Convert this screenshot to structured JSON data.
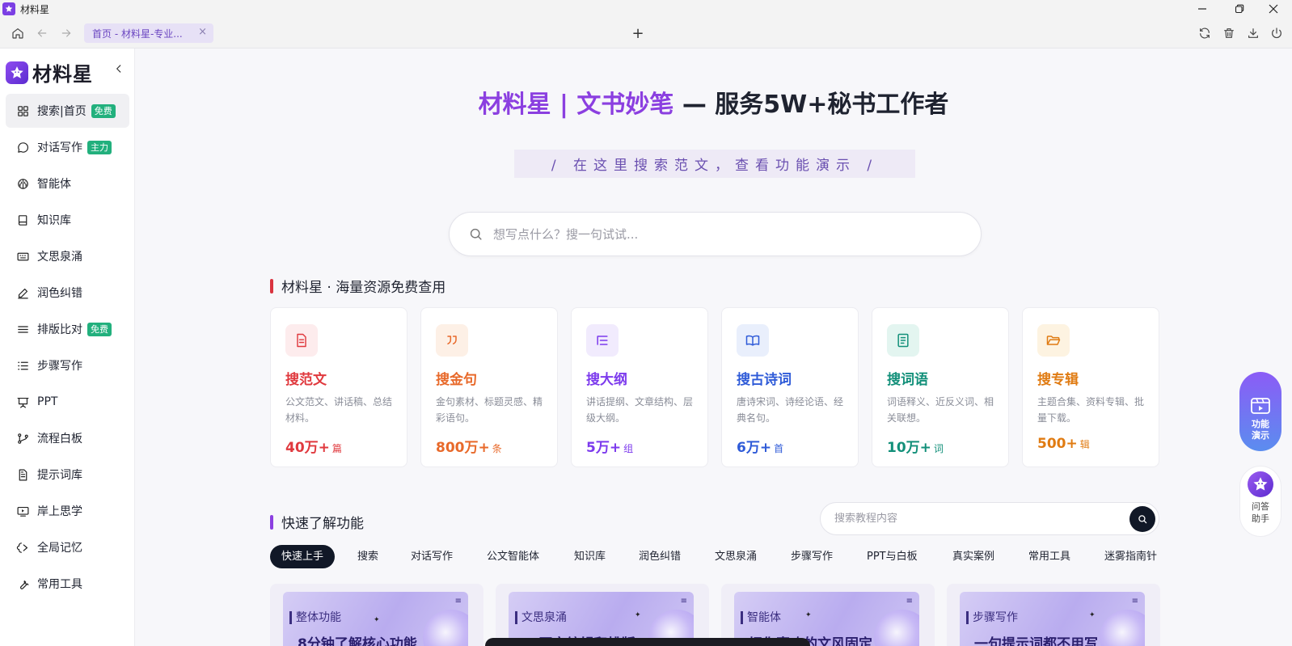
{
  "window": {
    "title": "材料星",
    "tab_label": "首页 - 材料星-专业...",
    "tab_close": "×",
    "new_tab": "+"
  },
  "sidebar": {
    "brand_name": "材料星",
    "items": [
      {
        "label": "搜索|首页",
        "icon": "grid-icon",
        "badge": "免费",
        "active": true
      },
      {
        "label": "对话写作",
        "icon": "chat-bubble-icon",
        "badge": "主力"
      },
      {
        "label": "智能体",
        "icon": "brain-icon"
      },
      {
        "label": "知识库",
        "icon": "book-icon"
      },
      {
        "label": "文思泉涌",
        "icon": "keyboard-icon"
      },
      {
        "label": "润色纠错",
        "icon": "pen-icon"
      },
      {
        "label": "排版比对",
        "icon": "lines-icon",
        "badge": "免费"
      },
      {
        "label": "步骤写作",
        "icon": "list-steps-icon"
      },
      {
        "label": "PPT",
        "icon": "presentation-icon"
      },
      {
        "label": "流程白板",
        "icon": "flow-branch-icon"
      },
      {
        "label": "提示词库",
        "icon": "document-icon"
      },
      {
        "label": "岸上思学",
        "icon": "video-screen-icon"
      },
      {
        "label": "全局记忆",
        "icon": "memory-icon"
      },
      {
        "label": "常用工具",
        "icon": "wrench-icon"
      }
    ]
  },
  "hero": {
    "title_brand": "材料星 | 文书妙笔",
    "title_rest": " — 服务5W+秘书工作者",
    "subtitle": "/ 在这里搜索范文，查看功能演示 /",
    "search_placeholder": "想写点什么？搜一句试试..."
  },
  "resources": {
    "section_title": "材料星 · 海量资源免费查用",
    "cards": [
      {
        "title": "搜范文",
        "desc": "公文范文、讲话稿、总结材料。",
        "count": "40万+",
        "unit": "篇",
        "color": "#e0393e",
        "bg": "#fdeced",
        "icon": "file-text-icon"
      },
      {
        "title": "搜金句",
        "desc": "金句素材、标题灵感、精彩语句。",
        "count": "800万+",
        "unit": "条",
        "color": "#e8692a",
        "bg": "#fdf0e6",
        "icon": "quote-icon"
      },
      {
        "title": "搜大纲",
        "desc": "讲话提纲、文章结构、层级大纲。",
        "count": "5万+",
        "unit": "组",
        "color": "#7c3aed",
        "bg": "#f1ebfd",
        "icon": "outline-list-icon"
      },
      {
        "title": "搜古诗词",
        "desc": "唐诗宋词、诗经论语、经典名句。",
        "count": "6万+",
        "unit": "首",
        "color": "#2f5bd8",
        "bg": "#e9effc",
        "icon": "open-book-icon"
      },
      {
        "title": "搜词语",
        "desc": "词语释义、近反义词、相关联想。",
        "count": "10万+",
        "unit": "词",
        "color": "#13907a",
        "bg": "#e3f5f0",
        "icon": "dictionary-icon"
      },
      {
        "title": "搜专辑",
        "desc": "主题合集、资料专辑、批量下载。",
        "count": "500+",
        "unit": "辑",
        "color": "#e07b12",
        "bg": "#fdf3e1",
        "icon": "folder-open-icon"
      }
    ]
  },
  "tutorials": {
    "section_title": "快速了解功能",
    "search_placeholder": "搜索教程内容",
    "chips": [
      "快速上手",
      "搜索",
      "对话写作",
      "公文智能体",
      "知识库",
      "润色纠错",
      "文思泉涌",
      "步骤写作",
      "PPT与白板",
      "真实案例",
      "常用工具",
      "迷雾指南针"
    ],
    "videos": [
      {
        "tag": "整体功能",
        "headline": "8分钟了解核心功能"
      },
      {
        "tag": "文思泉涌",
        "headline": "AI写完编辑和排版"
      },
      {
        "tag": "智能体",
        "headline": "把你喜欢的文风固定"
      },
      {
        "tag": "步骤写作",
        "headline": "一句提示词都不用写"
      }
    ]
  },
  "floating": {
    "demo_label": "功能演示",
    "help_label": "问答助手"
  },
  "colors": {
    "brand_purple": "#8b3fe0",
    "badge_green": "#22b07d",
    "section_bar_red": "#d9333f",
    "section_bar_purple": "#8b3fe0"
  }
}
